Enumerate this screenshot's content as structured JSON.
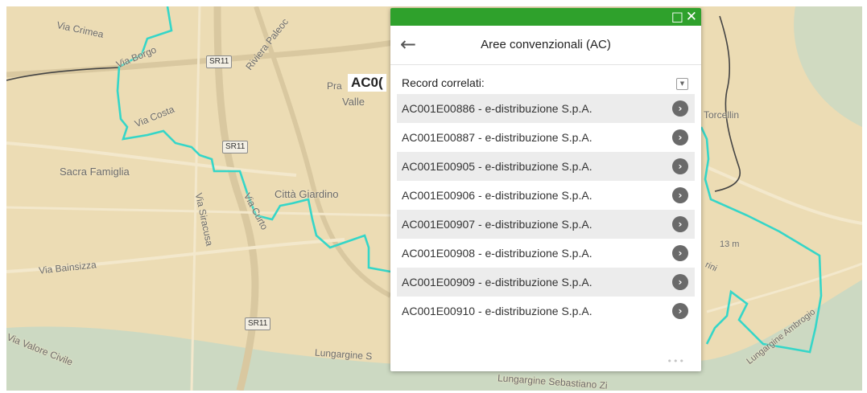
{
  "popup": {
    "title": "Aree convenzionali (AC)",
    "section_label": "Record correlati:",
    "records": [
      "AC001E00886 - e-distribuzione S.p.A.",
      "AC001E00887 - e-distribuzione S.p.A.",
      "AC001E00905 - e-distribuzione S.p.A.",
      "AC001E00906 - e-distribuzione S.p.A.",
      "AC001E00907 - e-distribuzione S.p.A.",
      "AC001E00908 - e-distribuzione S.p.A.",
      "AC001E00909 - e-distribuzione S.p.A.",
      "AC001E00910 - e-distribuzione S.p.A."
    ],
    "more_label": "•••",
    "icons": {
      "maximize": "maximize-icon",
      "close": "close-icon",
      "back": "arrow-left-icon",
      "collapse": "caret-down-icon",
      "open_record": "chevron-right-icon"
    },
    "titlebar_color": "#2fa12c"
  },
  "map": {
    "tooltip": "AC0(",
    "labels": {
      "via_crimea": "Via Crimea",
      "via_borgo": "Via Borgo",
      "riviera_paleo": "Riviera Paleoc",
      "pra": "Pra",
      "valle": "Valle",
      "via_costa": "Via Costa",
      "sacra_famiglia": "Sacra Famiglia",
      "via_siracusa": "Via Siracusa",
      "via_curtatone": "Via Curto",
      "citta_giardino": "Città Giardino",
      "via_bainsizza": "Via Bainsizza",
      "via_valore_civile": "Via Valore Civile",
      "lungargine_s": "Lungargine S",
      "lungargine_bottom": "Lungargine Sebastiano Zi",
      "torcellin": "Torcellin",
      "elevation": "13 m",
      "lungargine_right": "Lungargine Ambrogio",
      "rini": "rini"
    },
    "shields": [
      "SR11",
      "SR11",
      "SR11"
    ],
    "colors": {
      "background": "#ecdcb4",
      "boundary": "#35d6c8",
      "river": "#bfd7c8"
    }
  }
}
